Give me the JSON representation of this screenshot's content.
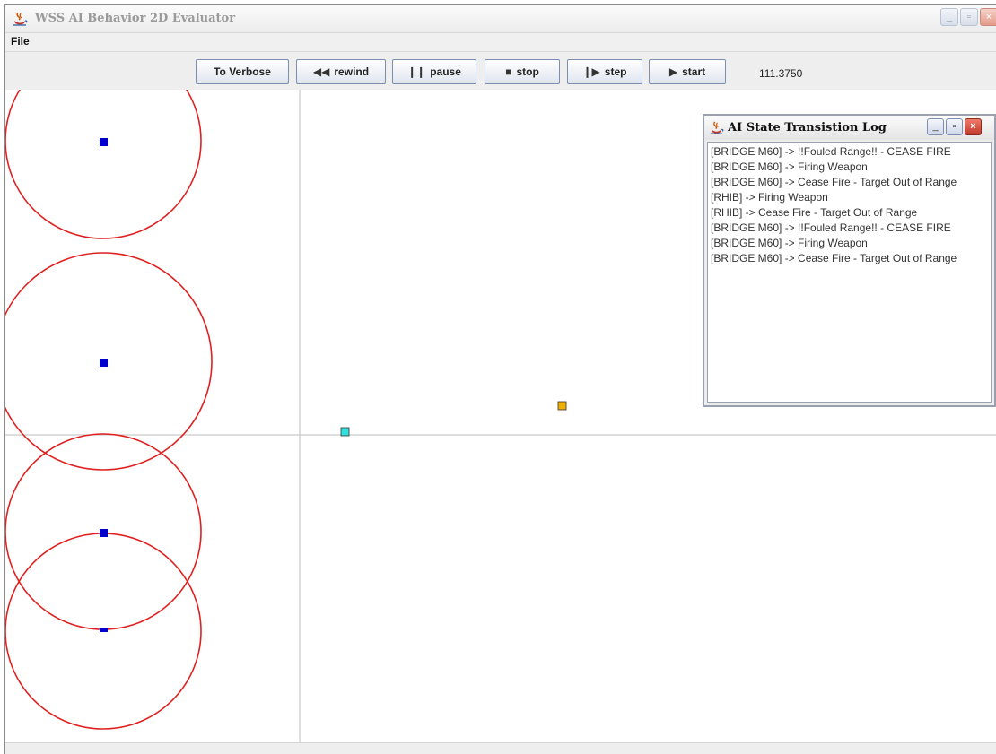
{
  "window": {
    "title": "WSS AI Behavior 2D Evaluator",
    "controls": {
      "minimize": "_",
      "maximize": "▫",
      "close": "×"
    }
  },
  "menu": {
    "items": [
      {
        "label": "File"
      }
    ]
  },
  "toolbar": {
    "verbose_label": "To Verbose",
    "rewind_label": "rewind",
    "pause_label": "pause",
    "stop_label": "stop",
    "step_label": "step",
    "start_label": "start",
    "time": "111.3750",
    "icons": {
      "rewind": "◀◀",
      "pause": "❙❙",
      "stop": "■",
      "step": "❙▶",
      "start": "▶"
    }
  },
  "log_window": {
    "title": "AI State Transistion Log",
    "lines": [
      "[BRIDGE M60] -> !!Fouled Range!! - CEASE FIRE",
      "[BRIDGE M60] -> Firing Weapon",
      "[BRIDGE M60] -> Cease Fire - Target Out of Range",
      "[RHIB] -> Firing Weapon",
      "[RHIB] -> Cease Fire - Target Out of Range",
      "[BRIDGE M60] -> !!Fouled Range!! - CEASE FIRE",
      "[BRIDGE M60] -> Firing Weapon",
      "[BRIDGE M60] -> Cease Fire - Target Out of Range"
    ]
  },
  "colors": {
    "range_circle": "#e02020",
    "unit_blue": "#0000cc",
    "unit_cyan": "#33e0e0",
    "unit_orange": "#f0b000",
    "axis": "#bbbbbb"
  }
}
